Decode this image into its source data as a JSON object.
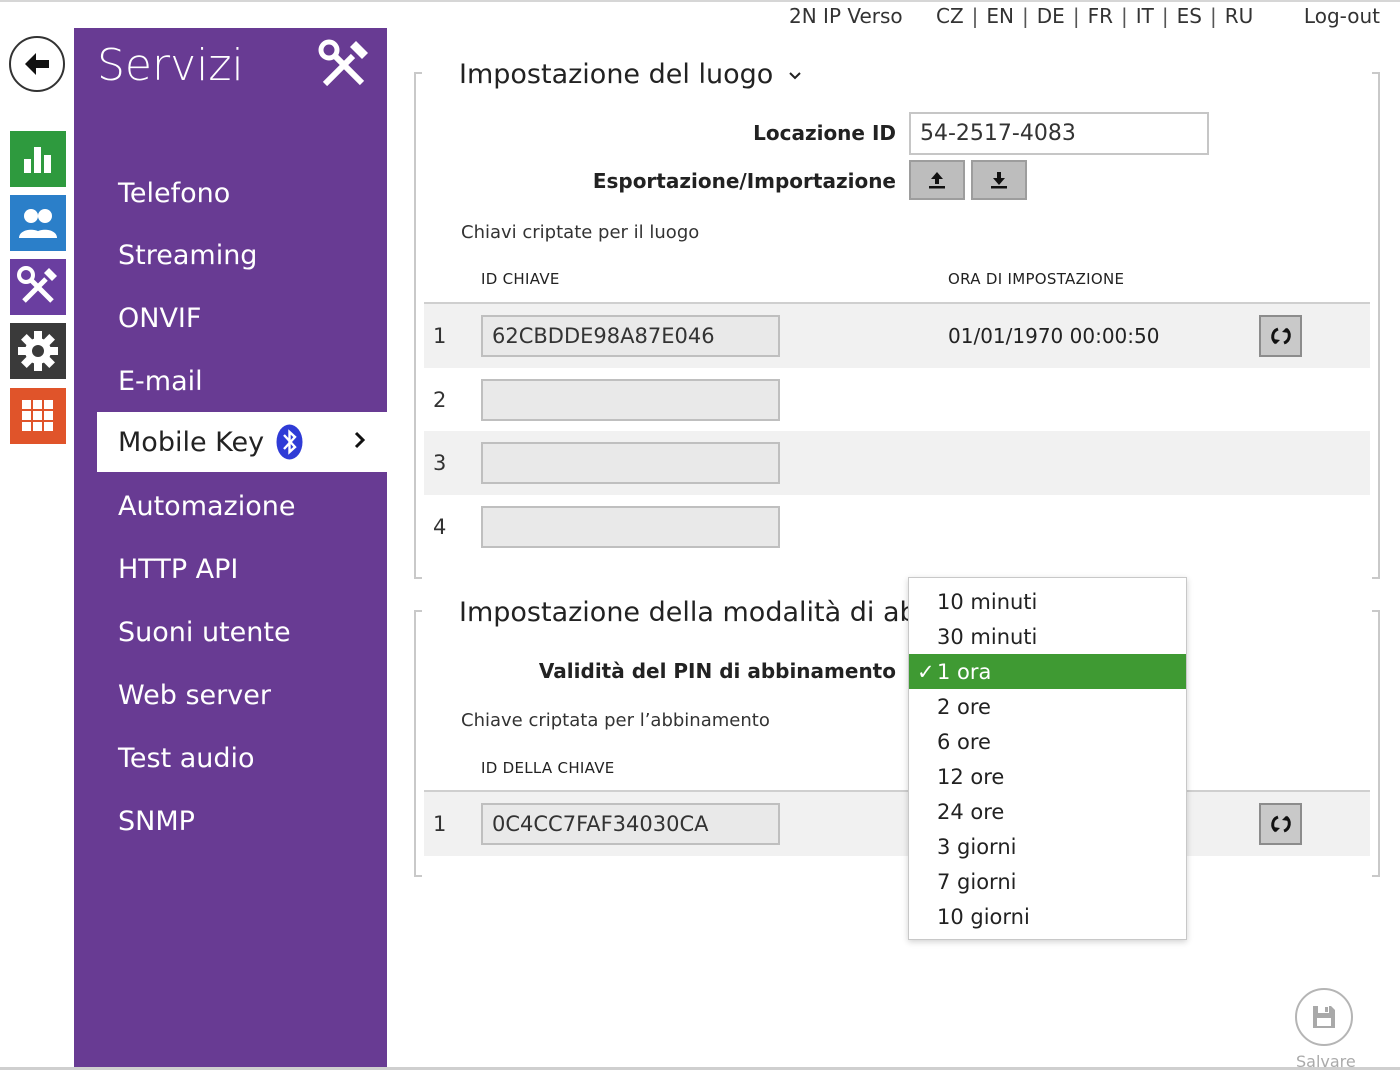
{
  "topbar": {
    "device": "2N IP Verso",
    "languages": [
      "CZ",
      "EN",
      "DE",
      "FR",
      "IT",
      "ES",
      "RU"
    ],
    "separator": "|",
    "logout": "Log-out"
  },
  "sidebar": {
    "title": "Servizi",
    "items": [
      {
        "label": "Telefono"
      },
      {
        "label": "Streaming"
      },
      {
        "label": "ONVIF"
      },
      {
        "label": "E-mail"
      },
      {
        "label": "Mobile Key",
        "active": true
      },
      {
        "label": "Automazione"
      },
      {
        "label": "HTTP API"
      },
      {
        "label": "Suoni utente"
      },
      {
        "label": "Web server"
      },
      {
        "label": "Test audio"
      },
      {
        "label": "SNMP"
      }
    ]
  },
  "site": {
    "title": "Impostazione del luogo",
    "location_id_label": "Locazione ID",
    "location_id_value": "54-2517-4083",
    "export_import_label": "Esportazione/Importazione",
    "keys_subtitle": "Chiavi criptate per il luogo",
    "col_key_id": "ID CHIAVE",
    "col_set_time": "ORA DI IMPOSTAZIONE",
    "rows": [
      {
        "num": "1",
        "key": "62CBDDE98A87E046",
        "time": "01/01/1970 00:00:50"
      },
      {
        "num": "2",
        "key": "",
        "time": ""
      },
      {
        "num": "3",
        "key": "",
        "time": ""
      },
      {
        "num": "4",
        "key": "",
        "time": ""
      }
    ]
  },
  "pairing": {
    "title": "Impostazione della modalità di abbin",
    "pin_validity_label": "Validità del PIN di abbinamento",
    "keys_subtitle": "Chiave criptata per l’abbinamento",
    "col_key_id": "ID DELLA CHIAVE",
    "rows": [
      {
        "num": "1",
        "key": "0C4CC7FAF34030CA"
      }
    ]
  },
  "pin_validity_dropdown": {
    "options": [
      "10 minuti",
      "30 minuti",
      "1 ora",
      "2 ore",
      "6 ore",
      "12 ore",
      "24 ore",
      "3 giorni",
      "7 giorni",
      "10 giorni"
    ],
    "selected": "1 ora",
    "check_mark": "✓",
    "selected_color": "#3f9a33"
  },
  "save": {
    "label": "Salvare"
  },
  "colors": {
    "sidebar": "#683b93",
    "status": "#2e9a3e",
    "users": "#2b7fc9",
    "services": "#6a3ea0",
    "hardware": "#3a3a3a",
    "system": "#e0542a"
  },
  "icons": {
    "back": "back-arrow-icon",
    "status": "bar-chart-icon",
    "users": "users-icon",
    "services": "tools-icon",
    "hardware": "gear-icon",
    "system": "grid-icon",
    "bluetooth": "bluetooth-icon",
    "upload": "upload-icon",
    "download": "download-icon",
    "refresh": "refresh-icon",
    "save": "floppy-icon"
  }
}
